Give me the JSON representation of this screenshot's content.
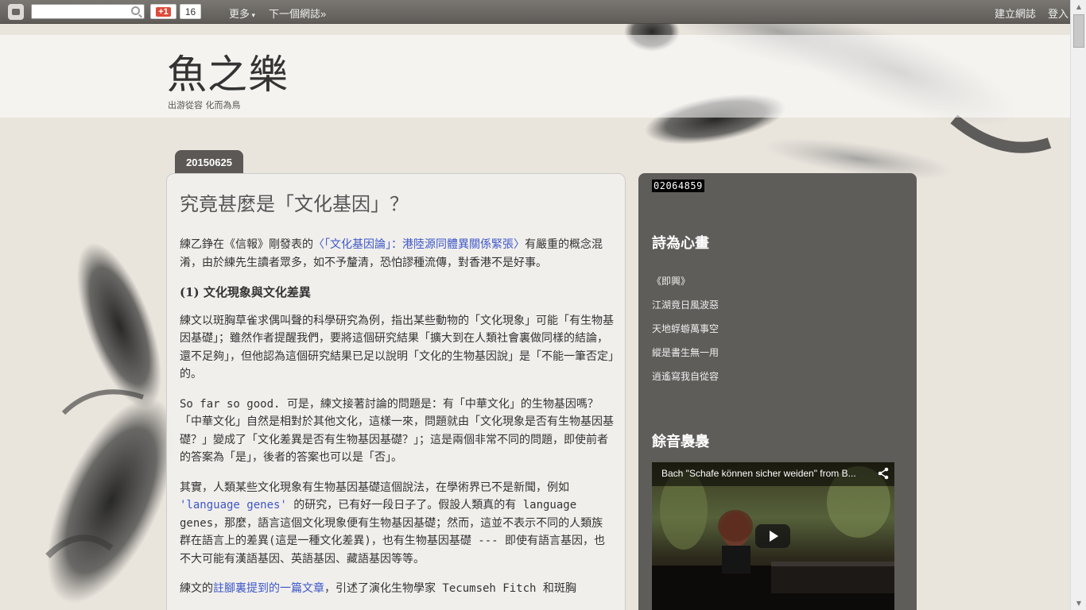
{
  "navbar": {
    "plusone_label": "+1",
    "plusone_count": "16",
    "more_label": "更多",
    "next_blog_label": "下一個網誌»",
    "create_blog_label": "建立網誌",
    "login_label": "登入"
  },
  "blog": {
    "title": "魚之樂",
    "description": "出游從容 化而為鳥"
  },
  "post": {
    "date": "20150625",
    "title": "究竟甚麼是「文化基因」？",
    "p1_a": "練乙錚在《信報》剛發表的",
    "p1_link": "〈「文化基因論」：港陸源同體異關係緊張〉",
    "p1_b": "有嚴重的概念混淆，由於練先生讀者眾多，如不予釐清，恐怕謬種流傳，對香港不是好事。",
    "heading1": "(1) 文化現象與文化差異",
    "p2": "練文以斑胸草雀求偶叫聲的科學研究為例，指出某些動物的「文化現象」可能「有生物基因基礎」；雖然作者提醒我們，要將這個研究結果「擴大到在人類社會裏做同樣的結論，還不足夠」，但他認為這個研究結果已足以說明「文化的生物基因說」是「不能一筆否定」的。",
    "p3": "So far so good. 可是，練文接著討論的問題是：有「中華文化」的生物基因嗎？「中華文化」自然是相對於其他文化，這樣一來，問題就由「文化現象是否有生物基因基礎？」變成了「文化差異是否有生物基因基礎？」；這是兩個非常不同的問題，即使前者的答案為「是」，後者的答案也可以是「否」。",
    "p4_a": "其實，人類某些文化現象有生物基因基礎這個說法，在學術界已不是新聞，例如 ",
    "p4_link": "'language genes'",
    "p4_b": " 的研究，已有好一段日子了。假設人類真的有 language genes，那麼，語言這個文化現象便有生物基因基礎；然而，這並不表示不同的人類族群在語言上的差異(這是一種文化差異)，也有生物基因基礎 --- 即使有語言基因，也不大可能有漢語基因、英語基因、藏語基因等等。",
    "p5_a": "練文的",
    "p5_link": "註腳裏提到的一篇文章",
    "p5_b": "，引述了演化生物學家 Tecumseh Fitch 和斑胸"
  },
  "sidebar": {
    "counter": "02064859",
    "poem_heading": "詩為心畫",
    "poem_lines": [
      "《即興》",
      "江湖竟日風波惡",
      "天地蜉蝣萬事空",
      "縱是書生無一用",
      "逍遙寫我自從容"
    ],
    "music_heading": "餘音裊裊",
    "video_title": "Bach \"Schafe können sicher weiden\" from B..."
  },
  "colors": {
    "navbar": "#6b6864",
    "sidebar": "#5f5d5a",
    "link": "#3d57c9",
    "date_tab": "#5b5855"
  }
}
